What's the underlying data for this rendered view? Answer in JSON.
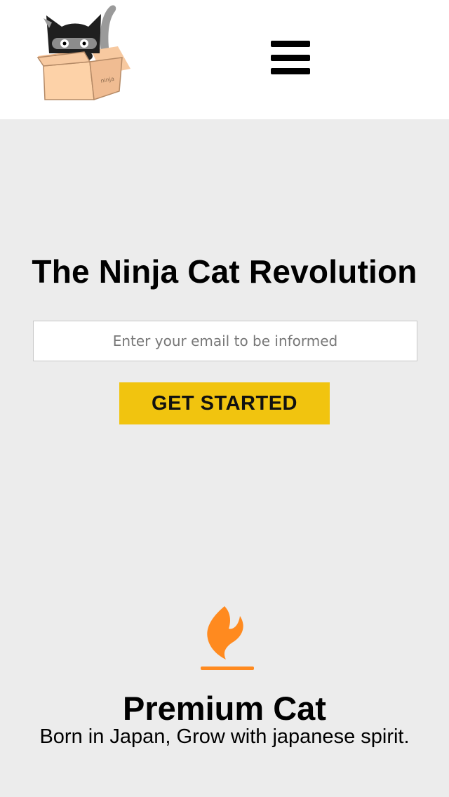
{
  "header": {
    "logo_icon": "ninja-cat-in-box-logo",
    "menu_icon": "hamburger-menu-icon"
  },
  "hero": {
    "title": "The Ninja Cat Revolution",
    "email_placeholder": "Enter your email to be informed",
    "email_value": "",
    "cta_label": "GET STARTED"
  },
  "feature": {
    "icon": "flame-icon",
    "title": "Premium Cat",
    "description": "Born in Japan, Grow with japanese spirit."
  },
  "colors": {
    "background": "#ececec",
    "header_bg": "#ffffff",
    "cta": "#f1c40f",
    "flame": "#ff8a1f"
  }
}
